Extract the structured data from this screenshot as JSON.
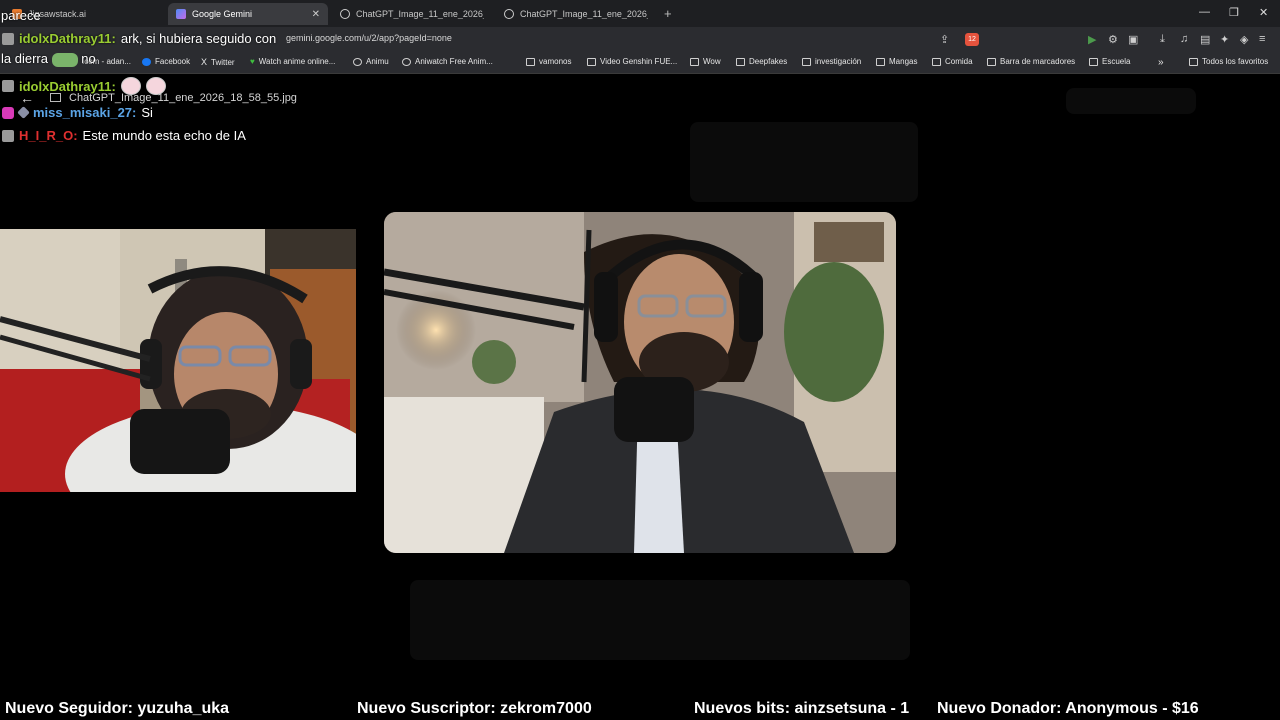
{
  "browser": {
    "tabs": [
      {
        "title": "Jigsawstack.ai",
        "active": false
      },
      {
        "title": "Google Gemini",
        "active": true
      },
      {
        "title": "ChatGPT_Image_11_ene_2026_18_58",
        "active": false
      },
      {
        "title": "ChatGPT_Image_11_ene_2026_18_58",
        "active": false
      }
    ],
    "url": "gemini.google.com/u/2/app?pageId=none",
    "notifications_badge": "12",
    "bookmarks": [
      {
        "label": ".com - adan...",
        "icon": "site-icon"
      },
      {
        "label": "Facebook",
        "icon": "facebook-icon"
      },
      {
        "label": "Twitter",
        "icon": "x-icon"
      },
      {
        "label": "Watch anime online...",
        "icon": "heart-icon"
      },
      {
        "label": "Animu",
        "icon": "globe-icon"
      },
      {
        "label": "Aniwatch Free Anim...",
        "icon": "globe-icon"
      },
      {
        "label": "vamonos",
        "icon": "folder-icon"
      },
      {
        "label": "Video Genshin FUE...",
        "icon": "folder-icon"
      },
      {
        "label": "Wow",
        "icon": "folder-icon"
      },
      {
        "label": "Deepfakes",
        "icon": "folder-icon"
      },
      {
        "label": "investigación",
        "icon": "folder-icon"
      },
      {
        "label": "Mangas",
        "icon": "folder-icon"
      },
      {
        "label": "Comida",
        "icon": "folder-icon"
      },
      {
        "label": "Barra de marcadores",
        "icon": "folder-icon"
      },
      {
        "label": "Escuela",
        "icon": "folder-icon"
      }
    ],
    "bookmarks_more": "»",
    "all_favorites": "Todos los favoritos"
  },
  "viewer": {
    "filename": "ChatGPT_Image_11_ene_2026_18_58_55.jpg"
  },
  "chat": {
    "floating_top": "parece",
    "floating_mid": "la dierra",
    "floating_no": "no",
    "messages": [
      {
        "user": "idolxDathray11",
        "text": "ark, si hubiera seguido con",
        "user_color": "#9acd32"
      },
      {
        "user": "idolxDathray11",
        "text": "",
        "user_color": "#9acd32"
      },
      {
        "user": "miss_misaki_27",
        "text": "Si",
        "user_color": "#5ba4e6"
      },
      {
        "user": "H_I_R_O",
        "text": "Este mundo esta echo de IA",
        "user_color": "#e03030"
      }
    ]
  },
  "alerts": {
    "follower": "Nuevo Seguidor: yuzuha_uka",
    "subscriber": "Nuevo Suscriptor: zekrom7000",
    "bits": "Nuevos bits: ainzsetsuna - 1",
    "donor": "Nuevo Donador: Anonymous - $16"
  }
}
